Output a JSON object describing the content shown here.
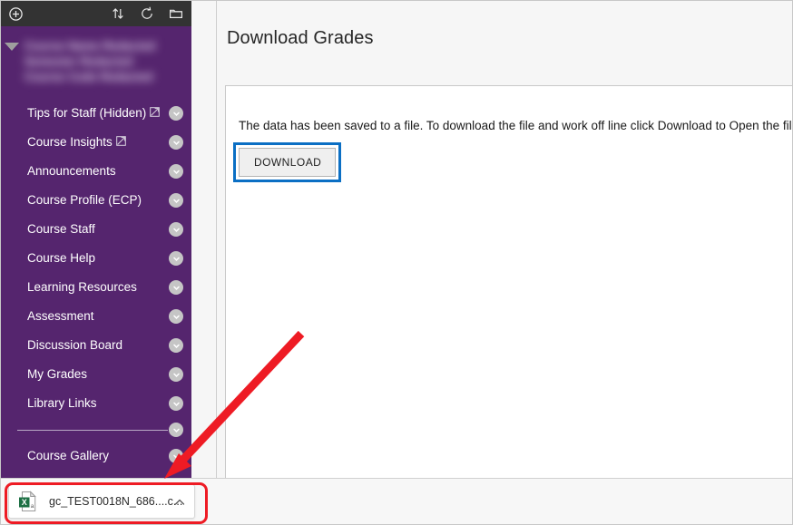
{
  "window": {
    "background_color": "#ffffff",
    "accent_purple": "#55256e",
    "annotation_color": "#ee1b24",
    "focus_ring_color": "#0b6fc4"
  },
  "menu_toolbar": {
    "icons": [
      {
        "name": "add-circle-icon",
        "glyph": "plus-in-circle"
      },
      {
        "name": "reorder-icon",
        "glyph": "up-down-arrows"
      },
      {
        "name": "refresh-icon",
        "glyph": "circular-arrow"
      },
      {
        "name": "folder-icon",
        "glyph": "folder"
      }
    ]
  },
  "course_header": {
    "redacted_lines": [
      "Course Name Redacted",
      "Semester Redacted",
      "Course Code Redacted"
    ],
    "collapse_control": "collapse-arrow"
  },
  "sidebar": {
    "items": [
      {
        "label": "Tips for Staff (Hidden)",
        "external": true
      },
      {
        "label": "Course Insights",
        "external": true
      },
      {
        "label": "Announcements",
        "external": false
      },
      {
        "label": "Course Profile (ECP)",
        "external": false
      },
      {
        "label": "Course Staff",
        "external": false
      },
      {
        "label": "Course Help",
        "external": false
      },
      {
        "label": "Learning Resources",
        "external": false
      },
      {
        "label": "Assessment",
        "external": false
      },
      {
        "label": "Discussion Board",
        "external": false
      },
      {
        "label": "My Grades",
        "external": false
      },
      {
        "label": "Library Links",
        "external": false
      }
    ],
    "divider": true,
    "items_after_divider": [
      {
        "label": "Course Gallery",
        "external": false
      }
    ]
  },
  "main": {
    "page_title": "Download Grades",
    "card": {
      "message": "The data has been saved to a file. To download the file and work off line click Download to Open the file.",
      "download_button_label": "DOWNLOAD"
    }
  },
  "download_shelf": {
    "file_name": "gc_TEST0018N_686....c...",
    "file_icon": "excel-csv-file-icon",
    "expand_icon": "chevron-up-icon"
  }
}
